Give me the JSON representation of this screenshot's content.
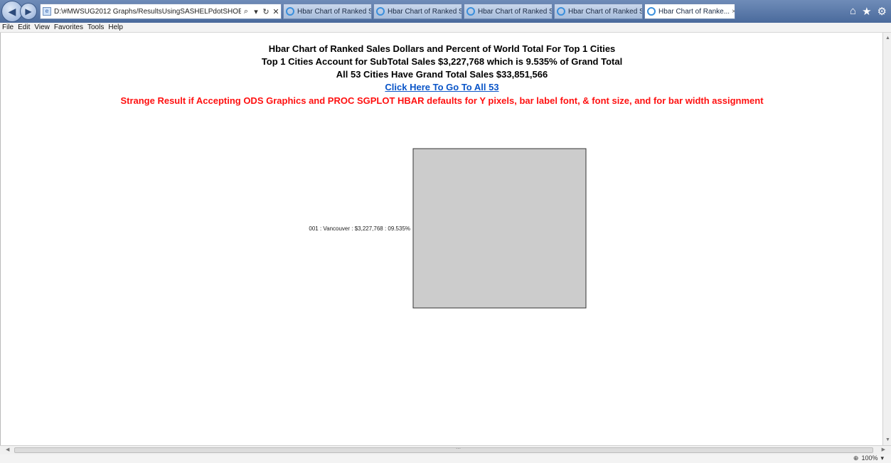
{
  "browser": {
    "address_url": "D:\\#MWSUG2012 Graphs/ResultsUsingSASHELPdotSHOES/",
    "tabs": [
      {
        "label": "Hbar Chart of Ranked S..."
      },
      {
        "label": "Hbar Chart of Ranked S..."
      },
      {
        "label": "Hbar Chart of Ranked S..."
      },
      {
        "label": "Hbar Chart of Ranked S..."
      },
      {
        "label": "Hbar Chart of Ranke..."
      }
    ],
    "active_tab_close": "×",
    "menu": [
      "File",
      "Edit",
      "View",
      "Favorites",
      "Tools",
      "Help"
    ],
    "zoom_level": "100%",
    "icons": {
      "back": "left-arrow-icon",
      "forward": "right-arrow-icon",
      "search": "search-icon",
      "refresh": "refresh-icon",
      "stop": "close-icon",
      "home": "home-icon",
      "favorites": "star-icon",
      "tools": "gear-icon"
    }
  },
  "page": {
    "title_line1": "Hbar Chart of Ranked Sales Dollars and Percent of World Total For Top 1 Cities",
    "title_line2": "Top 1 Cities Account for SubTotal Sales $3,227,768 which is 9.535% of Grand Total",
    "title_line3": "All 53 Cities Have Grand Total Sales $33,851,566",
    "link_text": "Click Here To Go To All 53",
    "warning_text": "Strange Result if Accepting ODS Graphics and PROC SGPLOT HBAR defaults for Y pixels, bar label font, & font size, and for bar width assignment",
    "colors": {
      "link": "#0a55c8",
      "warning": "#ff1010",
      "bar_fill": "#cccccc",
      "bar_stroke": "#333333"
    }
  },
  "chart_data": {
    "type": "bar",
    "orientation": "horizontal",
    "categories": [
      "001 : Vancouver : $3,227,768 : 09.535%"
    ],
    "values": [
      3227768
    ],
    "xlim": [
      0,
      3227768
    ],
    "grid": false
  }
}
